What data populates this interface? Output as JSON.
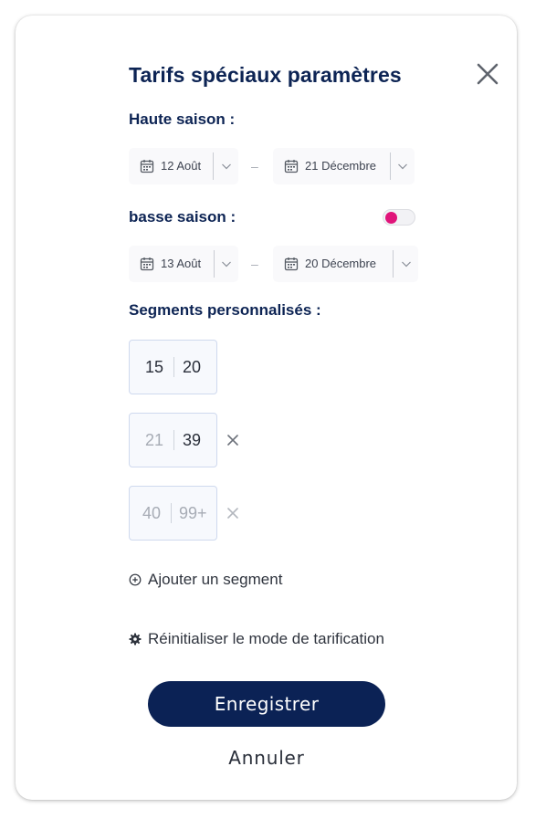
{
  "modal": {
    "title": "Tarifs spéciaux paramètres"
  },
  "high_season": {
    "label": "Haute saison :",
    "start_date": "12 Août",
    "end_date": "21 Décembre",
    "range_separator": "–"
  },
  "low_season": {
    "label": "basse saison :",
    "toggle_enabled": true,
    "start_date": "13 Août",
    "end_date": "20 Décembre",
    "range_separator": "–"
  },
  "segments": {
    "label": "Segments personnalisés :",
    "items": [
      {
        "min": "15",
        "max": "20",
        "removable": false
      },
      {
        "min": "21",
        "max": "39",
        "removable": true
      },
      {
        "min": "40",
        "max": "99+",
        "removable": true
      }
    ],
    "add_label": "Ajouter un segment"
  },
  "reset_label": "Réinitialiser le mode de tarification",
  "buttons": {
    "save": "Enregistrer",
    "cancel": "Annuler"
  },
  "icons": {
    "close": "close-icon",
    "calendar": "calendar-icon",
    "chevron": "chevron-down-icon",
    "remove": "remove-segment-icon",
    "add": "plus-circle-icon",
    "reset": "gear-icon"
  },
  "colors": {
    "primary": "#0b2255",
    "accent": "#e0147a",
    "segment_border": "#cfd9ee"
  }
}
